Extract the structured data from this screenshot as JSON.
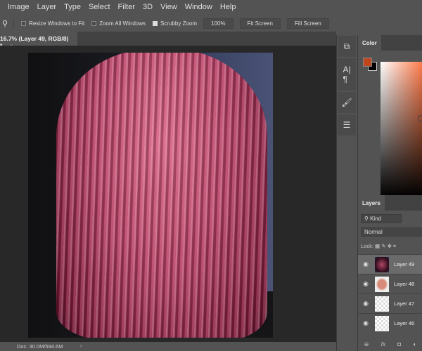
{
  "menu": [
    "Image",
    "Layer",
    "Type",
    "Select",
    "Filter",
    "3D",
    "View",
    "Window",
    "Help"
  ],
  "options": {
    "resize_windows": "Resize Windows to Fit",
    "zoom_all": "Zoom All Windows",
    "scrubby": "Scrubby Zoom",
    "zoom_value": "100%",
    "fit_screen": "Fit Screen",
    "fill_screen": "Fill Screen"
  },
  "document_tab": {
    "title": "16.7% (Layer 49, RGB/8) *",
    "close": "×"
  },
  "status": {
    "doc": "Doc: 30.0M/594.6M",
    "arrow": "›"
  },
  "color_panel": {
    "title": "Color",
    "foreground": "#c0461e",
    "background": "#000000"
  },
  "layers_panel": {
    "title": "Layers",
    "filter": "Kind",
    "blend_mode": "Normal",
    "lock_label": "Lock:",
    "layers": [
      {
        "name": "Layer 49",
        "active": true
      },
      {
        "name": "Layer 48"
      },
      {
        "name": "Layer 47"
      },
      {
        "name": "Layer 46"
      }
    ]
  }
}
